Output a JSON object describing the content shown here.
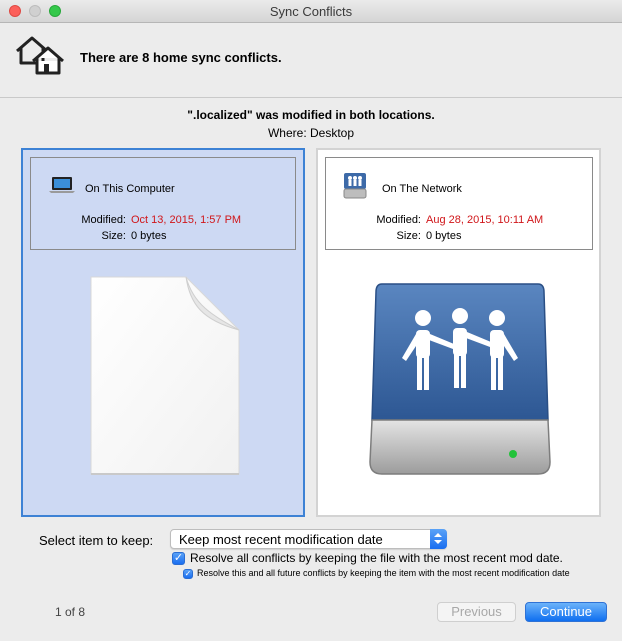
{
  "window": {
    "title": "Sync Conflicts"
  },
  "header": {
    "message": "There are 8 home sync conflicts."
  },
  "conflict": {
    "file_message": "\".localized\" was modified in both locations.",
    "where": "Where: Desktop"
  },
  "local": {
    "label": "On This Computer",
    "modified_label": "Modified:",
    "modified_value": "Oct 13, 2015, 1:57 PM",
    "size_label": "Size:",
    "size_value": "0 bytes",
    "selected": true,
    "icon": "laptop-icon",
    "image": "document-icon"
  },
  "network": {
    "label": "On The Network",
    "modified_label": "Modified:",
    "modified_value": "Aug 28, 2015, 10:11 AM",
    "size_label": "Size:",
    "size_value": "0 bytes",
    "selected": false,
    "icon": "server-icon",
    "image": "network-drive-icon"
  },
  "keep": {
    "label": "Select item to keep:",
    "selected_option": "Keep most recent modification date"
  },
  "options": {
    "resolve_all_label": "Resolve all conflicts by keeping the file with the most recent mod date.",
    "resolve_all_checked": true,
    "resolve_future_label": "Resolve this and all future conflicts by keeping the item with the most recent modification date",
    "resolve_future_checked": true
  },
  "footer": {
    "page_indicator": "1 of 8",
    "previous_label": "Previous",
    "continue_label": "Continue"
  },
  "colors": {
    "accent": "#1a6ef0",
    "selected_panel": "#cdd9f3",
    "modified_date": "#d0161a"
  }
}
